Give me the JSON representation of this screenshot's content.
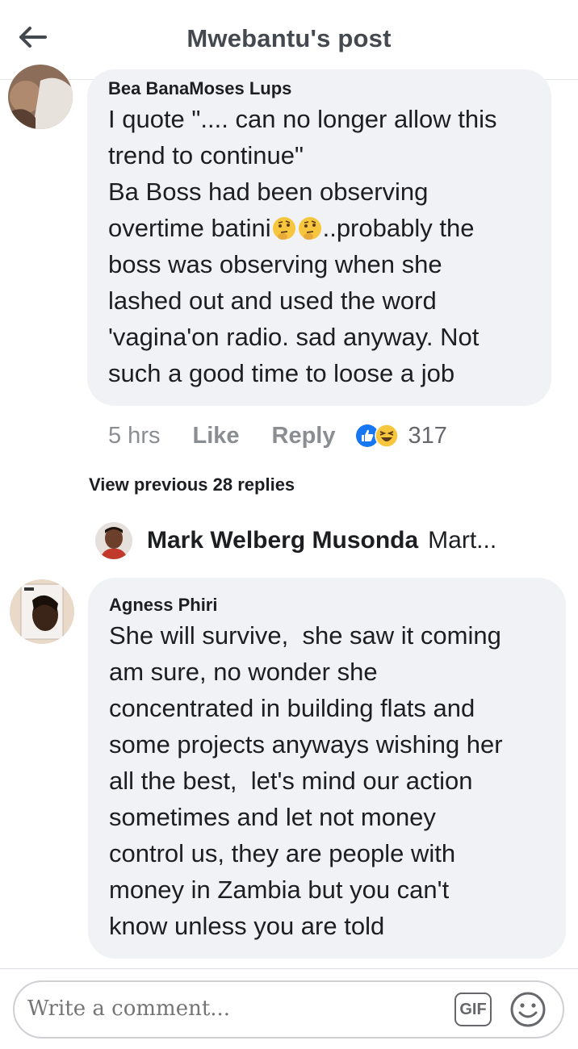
{
  "header": {
    "title": "Mwebantu's post"
  },
  "comments": [
    {
      "author": "Bea BanaMoses Lups",
      "text_a": "I quote \".... can no longer allow this\ntrend to continue\"\nBa Boss had been observing\novertime batini",
      "text_b": "..probably the\nboss was observing when she\nlashed out and used the word\n'vagina'on radio. sad anyway. Not\nsuch a good time to loose a job",
      "emoji": "thinking-face",
      "time": "5 hrs",
      "like_label": "Like",
      "reply_label": "Reply",
      "reaction_count": "317",
      "reaction_icons": [
        "like-reaction-icon",
        "haha-reaction-icon"
      ]
    },
    {
      "author": "Agness Phiri",
      "text": "She will survive,  she saw it coming\nam sure, no wonder she\nconcentrated in building flats and\nsome projects anyways wishing her\nall the best,  let's mind our action\nsometimes and let not money\ncontrol us, they are people with\nmoney in Zambia but you can't\nknow unless you are told"
    }
  ],
  "view_previous": "View previous 28 replies",
  "reply_preview": {
    "name": "Mark Welberg Musonda",
    "snippet": "Mart..."
  },
  "composer": {
    "placeholder": "Write a comment...",
    "gif_label": "GIF"
  },
  "colors": {
    "bubble": "#f0f2f5",
    "like_blue": "#1877f2",
    "haha_yellow": "#f7c63d",
    "muted_text": "#65676b"
  }
}
